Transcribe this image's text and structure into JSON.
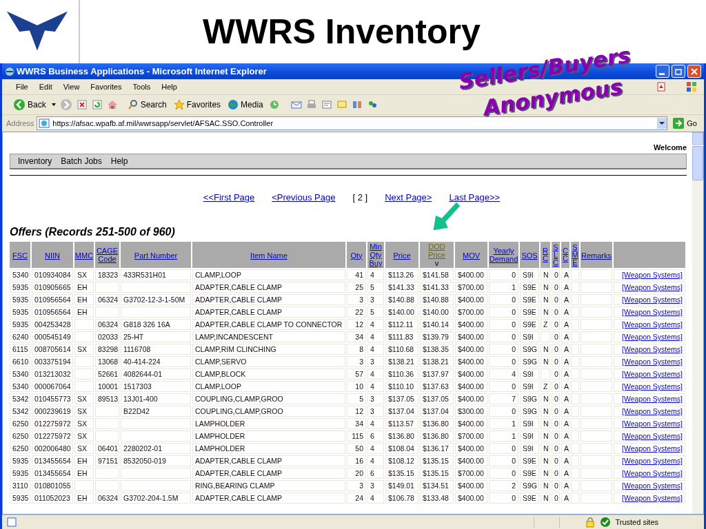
{
  "slide": {
    "title": "WWRS Inventory",
    "callout": [
      "Sellers/Buyers",
      "Anonymous"
    ]
  },
  "browser": {
    "title": "WWRS Business Applications - Microsoft Internet Explorer",
    "menu": [
      "File",
      "Edit",
      "View",
      "Favorites",
      "Tools",
      "Help"
    ],
    "toolbar": {
      "back": "Back",
      "search": "Search",
      "favorites": "Favorites",
      "media": "Media"
    },
    "address": {
      "label": "Address",
      "url": "https://afsac.wpafb.af.mil/wwrsapp/servlet/AFSAC.SSO.Controller",
      "go": "Go"
    },
    "status": {
      "zone": "Trusted sites"
    }
  },
  "page": {
    "welcome": "Welcome",
    "nav": [
      "Inventory",
      "Batch Jobs",
      "Help"
    ],
    "pagination": [
      {
        "label": "<<First Page",
        "kind": "link"
      },
      {
        "label": "<Previous Page",
        "kind": "link"
      },
      {
        "label": "[ 2 ]",
        "kind": "current"
      },
      {
        "label": "Next Page>",
        "kind": "link"
      },
      {
        "label": "Last Page>>",
        "kind": "link"
      }
    ],
    "heading": "Offers (Records 251-500 of 960)",
    "table": {
      "sort_mark": "v",
      "columns": [
        {
          "label": "FSC",
          "sorted": false,
          "kind": "text"
        },
        {
          "label": "NIIN",
          "sorted": false,
          "kind": "text"
        },
        {
          "label": "MMC",
          "sorted": false,
          "kind": "text"
        },
        {
          "label": "CAGE Code",
          "sorted": false,
          "kind": "text"
        },
        {
          "label": "Part Number",
          "sorted": false,
          "kind": "text"
        },
        {
          "label": "Item Name",
          "sorted": false,
          "kind": "text"
        },
        {
          "label": "Qty",
          "sorted": false,
          "kind": "text"
        },
        {
          "label": "Min Qty Buy",
          "sorted": false,
          "kind": "text"
        },
        {
          "label": "Price",
          "sorted": false,
          "kind": "text"
        },
        {
          "label": "DOD Price",
          "sorted": true,
          "kind": "text"
        },
        {
          "label": "MOV",
          "sorted": false,
          "kind": "text"
        },
        {
          "label": "Yearly Demand",
          "sorted": false,
          "kind": "text"
        },
        {
          "label": "SOS",
          "sorted": false,
          "kind": "text"
        },
        {
          "label": "RC",
          "sorted": false,
          "kind": "vertical"
        },
        {
          "label": "SLC",
          "sorted": false,
          "kind": "vertical"
        },
        {
          "label": "CC",
          "sorted": false,
          "kind": "vertical"
        },
        {
          "label": "SME",
          "sorted": false,
          "kind": "vertical"
        },
        {
          "label": "Remarks",
          "sorted": false,
          "kind": "text"
        }
      ],
      "rows": [
        {
          "fsc": "5340",
          "niin": "010934084",
          "mmc": "SX",
          "cage": "18323",
          "part": "433R531H01",
          "item": "CLAMP,LOOP",
          "qty": "41",
          "min": "4",
          "price": "$113.26",
          "dod": "$141.58",
          "mov": "$400.00",
          "yearly": "0",
          "sos": "S9I",
          "rc": "N",
          "slc": "0",
          "cc": "A",
          "link": "[Weapon Systems]"
        },
        {
          "fsc": "5935",
          "niin": "010905665",
          "mmc": "EH",
          "item": "ADAPTER,CABLE CLAMP",
          "qty": "25",
          "min": "5",
          "price": "$141.33",
          "dod": "$141.33",
          "mov": "$700.00",
          "yearly": "1",
          "sos": "S9E",
          "rc": "N",
          "slc": "0",
          "cc": "A",
          "link": "[Weapon Systems]"
        },
        {
          "fsc": "5935",
          "niin": "010956564",
          "mmc": "EH",
          "cage": "06324",
          "part": "G3702-12-3-1-50M",
          "item": "ADAPTER,CABLE CLAMP",
          "qty": "3",
          "min": "3",
          "price": "$140.88",
          "dod": "$140.88",
          "mov": "$400.00",
          "yearly": "0",
          "sos": "S9E",
          "rc": "N",
          "slc": "0",
          "cc": "A",
          "link": "[Weapon Systems]"
        },
        {
          "fsc": "5935",
          "niin": "010956564",
          "mmc": "EH",
          "item": "ADAPTER,CABLE CLAMP",
          "qty": "22",
          "min": "5",
          "price": "$140.00",
          "dod": "$140.00",
          "mov": "$700.00",
          "yearly": "0",
          "sos": "S9E",
          "rc": "N",
          "slc": "0",
          "cc": "A",
          "link": "[Weapon Systems]"
        },
        {
          "fsc": "5935",
          "niin": "004253428",
          "cage": "06324",
          "part": "G818 326 16A",
          "item": "ADAPTER,CABLE CLAMP TO CONNECTOR",
          "qty": "12",
          "min": "4",
          "price": "$112.11",
          "dod": "$140.14",
          "mov": "$400.00",
          "yearly": "0",
          "sos": "S9E",
          "rc": "Z",
          "slc": "0",
          "cc": "A",
          "link": "[Weapon Systems]"
        },
        {
          "fsc": "6240",
          "niin": "000545149",
          "cage": "02033",
          "part": "25-HT",
          "item": "LAMP,INCANDESCENT",
          "qty": "34",
          "min": "4",
          "price": "$111.83",
          "dod": "$139.79",
          "mov": "$400.00",
          "yearly": "0",
          "sos": "S9I",
          "slc": "0",
          "cc": "A",
          "link": "[Weapon Systems]"
        },
        {
          "fsc": "6115",
          "niin": "008705614",
          "mmc": "SX",
          "cage": "83298",
          "part": "1116708",
          "item": "CLAMP,RIM CLINCHING",
          "qty": "8",
          "min": "4",
          "price": "$110.68",
          "dod": "$138.35",
          "mov": "$400.00",
          "yearly": "0",
          "sos": "S9G",
          "rc": "N",
          "slc": "0",
          "cc": "A",
          "link": "[Weapon Systems]"
        },
        {
          "fsc": "6610",
          "niin": "003375194",
          "cage": "13068",
          "part": "40-414-224",
          "item": "CLAMP,SERVO",
          "qty": "3",
          "min": "3",
          "price": "$138.21",
          "dod": "$138.21",
          "mov": "$400.00",
          "yearly": "0",
          "sos": "S9G",
          "rc": "N",
          "slc": "0",
          "cc": "A",
          "link": "[Weapon Systems]"
        },
        {
          "fsc": "5340",
          "niin": "013213032",
          "cage": "52661",
          "part": "4082644-01",
          "item": "CLAMP,BLOCK",
          "qty": "57",
          "min": "4",
          "price": "$110.36",
          "dod": "$137.97",
          "mov": "$400.00",
          "yearly": "4",
          "sos": "S9I",
          "slc": "0",
          "cc": "A",
          "link": "[Weapon Systems]"
        },
        {
          "fsc": "5340",
          "niin": "000067064",
          "cage": "10001",
          "part": "1517303",
          "item": "CLAMP,LOOP",
          "qty": "10",
          "min": "4",
          "price": "$110.10",
          "dod": "$137.63",
          "mov": "$400.00",
          "yearly": "0",
          "sos": "S9I",
          "rc": "Z",
          "slc": "0",
          "cc": "A",
          "link": "[Weapon Systems]"
        },
        {
          "fsc": "5342",
          "niin": "010455773",
          "mmc": "SX",
          "cage": "89513",
          "part": "13J01-400",
          "item": "COUPLING,CLAMP,GROO",
          "qty": "5",
          "min": "3",
          "price": "$137.05",
          "dod": "$137.05",
          "mov": "$400.00",
          "yearly": "7",
          "sos": "S9G",
          "rc": "N",
          "slc": "0",
          "cc": "A",
          "link": "[Weapon Systems]"
        },
        {
          "fsc": "5342",
          "niin": "000239619",
          "mmc": "SX",
          "part": "B22D42",
          "item": "COUPLING,CLAMP,GROO",
          "qty": "12",
          "min": "3",
          "price": "$137.04",
          "dod": "$137.04",
          "mov": "$300.00",
          "yearly": "0",
          "sos": "S9G",
          "rc": "N",
          "slc": "0",
          "cc": "A",
          "link": "[Weapon Systems]"
        },
        {
          "fsc": "6250",
          "niin": "012275972",
          "mmc": "SX",
          "item": "LAMPHOLDER",
          "qty": "34",
          "min": "4",
          "price": "$113.57",
          "dod": "$136.80",
          "mov": "$400.00",
          "yearly": "1",
          "sos": "S9I",
          "rc": "N",
          "slc": "0",
          "cc": "A",
          "link": "[Weapon Systems]"
        },
        {
          "fsc": "6250",
          "niin": "012275972",
          "mmc": "SX",
          "item": "LAMPHOLDER",
          "qty": "115",
          "min": "6",
          "price": "$136.80",
          "dod": "$136.80",
          "mov": "$700.00",
          "yearly": "1",
          "sos": "S9I",
          "rc": "N",
          "slc": "0",
          "cc": "A",
          "link": "[Weapon Systems]"
        },
        {
          "fsc": "6250",
          "niin": "002006480",
          "mmc": "SX",
          "cage": "06401",
          "part": "2280202-01",
          "item": "LAMPHOLDER",
          "qty": "50",
          "min": "4",
          "price": "$108.04",
          "dod": "$136.17",
          "mov": "$400.00",
          "yearly": "0",
          "sos": "S9I",
          "rc": "N",
          "slc": "0",
          "cc": "A",
          "link": "[Weapon Systems]"
        },
        {
          "fsc": "5935",
          "niin": "013455654",
          "mmc": "EH",
          "cage": "97151",
          "part": "8532050-019",
          "item": "ADAPTER,CABLE CLAMP",
          "qty": "16",
          "min": "4",
          "price": "$108.12",
          "dod": "$135.15",
          "mov": "$400.00",
          "yearly": "0",
          "sos": "S9E",
          "rc": "N",
          "slc": "0",
          "cc": "A",
          "link": "[Weapon Systems]"
        },
        {
          "fsc": "5935",
          "niin": "013455654",
          "mmc": "EH",
          "item": "ADAPTER,CABLE CLAMP",
          "qty": "20",
          "min": "6",
          "price": "$135.15",
          "dod": "$135.15",
          "mov": "$700.00",
          "yearly": "0",
          "sos": "S9E",
          "rc": "N",
          "slc": "0",
          "cc": "A",
          "link": "[Weapon Systems]"
        },
        {
          "fsc": "3110",
          "niin": "010801055",
          "item": "RING,BEARING CLAMP",
          "qty": "3",
          "min": "3",
          "price": "$149.01",
          "dod": "$134.51",
          "mov": "$400.00",
          "yearly": "2",
          "sos": "S9G",
          "rc": "N",
          "slc": "0",
          "cc": "A",
          "link": "[Weapon Systems]"
        },
        {
          "fsc": "5935",
          "niin": "011052023",
          "mmc": "EH",
          "cage": "06324",
          "part": "G3702-204-1.5M",
          "item": "ADAPTER,CABLE CLAMP",
          "qty": "24",
          "min": "4",
          "price": "$106.78",
          "dod": "$133.48",
          "mov": "$400.00",
          "yearly": "0",
          "sos": "S9E",
          "rc": "N",
          "slc": "0",
          "cc": "A",
          "link": "[Weapon Systems]"
        }
      ]
    }
  }
}
